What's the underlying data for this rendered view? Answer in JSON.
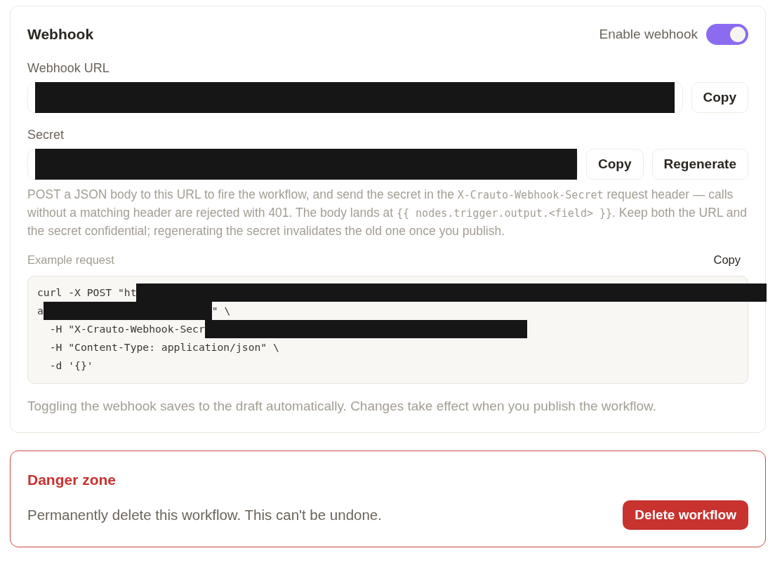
{
  "webhook": {
    "title": "Webhook",
    "enable_label": "Enable webhook",
    "enabled": true,
    "url_field": {
      "label": "Webhook URL",
      "redacted": true,
      "buttons": [
        "Copy"
      ]
    },
    "secret_field": {
      "label": "Secret",
      "redacted": true,
      "buttons": [
        "Copy",
        "Regenerate"
      ]
    },
    "description": [
      {
        "kind": "text",
        "text": "POST a JSON body to this URL to fire the workflow, and send the secret in the "
      },
      {
        "kind": "code",
        "text": "X-Crauto-Webhook-Secret"
      },
      {
        "kind": "text",
        "text": " request header — calls without a matching header are rejected with 401. The body lands at "
      },
      {
        "kind": "code",
        "text": "{{ nodes.trigger.output.<field> }}"
      },
      {
        "kind": "text",
        "text": ". Keep both the URL and the secret confidential; regenerating the secret invalidates the old one once you publish."
      }
    ],
    "example": {
      "label": "Example request",
      "copy_button": "Copy",
      "lines": [
        {
          "segments": [
            {
              "kind": "text",
              "text": "curl -X POST \"ht"
            },
            {
              "kind": "redacted"
            }
          ]
        },
        {
          "segments": [
            {
              "kind": "text",
              "text": "a"
            },
            {
              "kind": "redacted"
            },
            {
              "kind": "text",
              "text": "\" \\"
            }
          ]
        },
        {
          "segments": [
            {
              "kind": "text",
              "text": "  -H \"X-Crauto-Webhook-Secr"
            },
            {
              "kind": "redacted"
            }
          ]
        },
        {
          "segments": [
            {
              "kind": "text",
              "text": "  -H \"Content-Type: application/json\" \\"
            }
          ]
        },
        {
          "segments": [
            {
              "kind": "text",
              "text": "  -d '{}'"
            }
          ]
        }
      ]
    },
    "footnote": "Toggling the webhook saves to the draft automatically. Changes take effect when you publish the workflow."
  },
  "danger_zone": {
    "title": "Danger zone",
    "text": "Permanently delete this workflow. This can't be undone.",
    "button": "Delete workflow"
  }
}
